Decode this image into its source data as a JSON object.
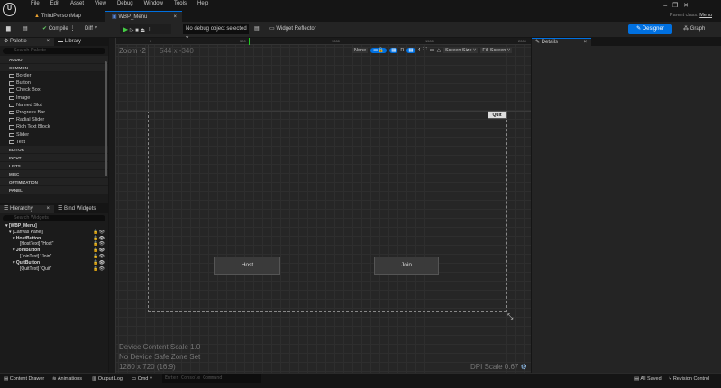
{
  "menu": [
    "File",
    "Edit",
    "Asset",
    "View",
    "Debug",
    "Window",
    "Tools",
    "Help"
  ],
  "tabs": [
    {
      "label": "ThirdPersonMap"
    },
    {
      "label": "WBP_Menu"
    }
  ],
  "parent_class": {
    "label": "Parent class:",
    "value": "Menu"
  },
  "toolbar": {
    "compile": "Compile",
    "diff": "Diff",
    "debug_select": "No debug object selected",
    "widget_reflector": "Widget Reflector",
    "designer": "Designer",
    "graph": "Graph"
  },
  "palette": {
    "title": "Palette",
    "library": "Library",
    "search_placeholder": "Search Palette",
    "categories_top": [
      "AUDIO"
    ],
    "common": "COMMON",
    "items": [
      "Border",
      "Button",
      "Check Box",
      "Image",
      "Named Slot",
      "Progress Bar",
      "Radial Slider",
      "Rich Text Block",
      "Slider",
      "Text"
    ],
    "categories_bottom": [
      "EDITOR",
      "INPUT",
      "LISTS",
      "MISC",
      "OPTIMIZATION",
      "PANEL"
    ]
  },
  "hierarchy": {
    "title": "Hierarchy",
    "bind": "Bind Widgets",
    "search_placeholder": "Search Widgets",
    "rows": [
      "[WBP_Menu]",
      "[Canvas Panel]",
      "HostButton",
      "[HostText] \"Host\"",
      "JoinButton",
      "[JoinText] \"Join\"",
      "QuitButton",
      "[QuitText] \"Quit\""
    ]
  },
  "viewport": {
    "zoom": "Zoom -2",
    "coords": "544 x -340",
    "ruler": [
      "0",
      "500",
      "1000",
      "1500",
      "2000"
    ],
    "none": "None",
    "grid": "4",
    "screen_size": "Screen Size",
    "fill_screen": "Fill Screen",
    "r": "R",
    "device_scale": "Device Content Scale 1.0",
    "safe_zone": "No Device Safe Zone Set",
    "resolution": "1280 x 720 (16:9)",
    "dpi": "DPI Scale 0.67"
  },
  "widgets": {
    "host": "Host",
    "join": "Join",
    "quit": "Quit"
  },
  "details": {
    "title": "Details"
  },
  "status": {
    "content_drawer": "Content Drawer",
    "animations": "Animations",
    "output_log": "Output Log",
    "cmd": "Cmd",
    "console_placeholder": "Enter Console Command",
    "all_saved": "All Saved",
    "revision": "Revision Control"
  }
}
